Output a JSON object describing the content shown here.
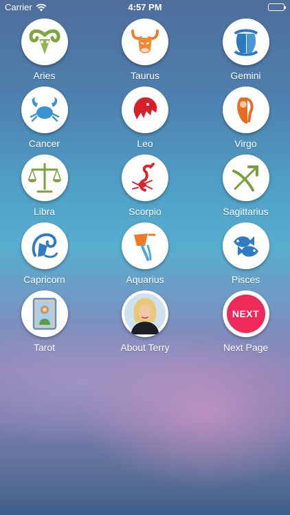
{
  "status_bar": {
    "carrier": "Carrier",
    "time": "4:57 PM"
  },
  "signs": [
    {
      "label": "Aries",
      "icon": "ram-icon",
      "color": "#7da640"
    },
    {
      "label": "Taurus",
      "icon": "bull-icon",
      "color": "#ec7d2b"
    },
    {
      "label": "Gemini",
      "icon": "twins-icon",
      "color": "#2e78c0"
    },
    {
      "label": "Cancer",
      "icon": "crab-icon",
      "color": "#3b93cf"
    },
    {
      "label": "Leo",
      "icon": "lion-icon",
      "color": "#d8202a"
    },
    {
      "label": "Virgo",
      "icon": "maiden-icon",
      "color": "#e66c23"
    },
    {
      "label": "Libra",
      "icon": "scales-icon",
      "color": "#7aa13c"
    },
    {
      "label": "Scorpio",
      "icon": "scorpion-icon",
      "color": "#d9262d"
    },
    {
      "label": "Sagittarius",
      "icon": "bow-arrow-icon",
      "color": "#78a13b"
    },
    {
      "label": "Capricorn",
      "icon": "goat-icon",
      "color": "#2f7cc4"
    },
    {
      "label": "Aquarius",
      "icon": "water-bearer-icon",
      "color": "#ee7a2a"
    },
    {
      "label": "Pisces",
      "icon": "fish-icon",
      "color": "#2f7cc4"
    }
  ],
  "extras": [
    {
      "label": "Tarot",
      "icon": "tarot-card-icon"
    },
    {
      "label": "About Terry",
      "icon": "terry-portrait-icon"
    },
    {
      "label": "Next Page",
      "icon": "next-badge-icon",
      "badge_text": "NEXT",
      "color": "#ef2a5b"
    }
  ]
}
